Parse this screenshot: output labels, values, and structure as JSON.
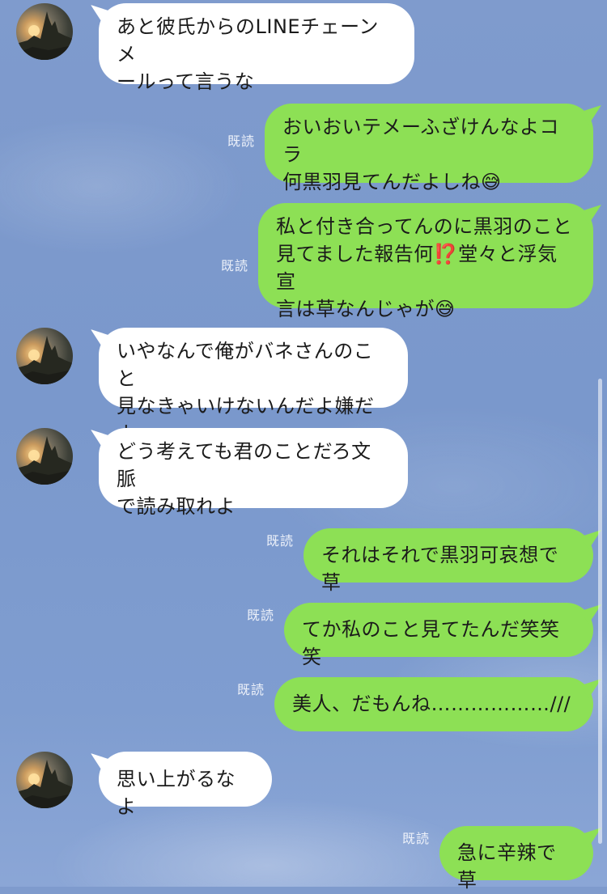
{
  "messages": [
    {
      "side": "in",
      "text": "あと彼氏からのLINEチェーンメ\nールって言うな"
    },
    {
      "side": "out",
      "read": "既読",
      "text": "おいおいテメーふざけんなよコラ\n何黒羽見てんだよしね😅"
    },
    {
      "side": "out",
      "read": "既読",
      "text": "私と付き合ってんのに黒羽のこと\n見てました報告何⁉️堂々と浮気宣\n言は草なんじゃが😅"
    },
    {
      "side": "in",
      "text": "いやなんで俺がバネさんのこと\n見なきゃいけないんだよ嫌だよ"
    },
    {
      "side": "in",
      "text": "どう考えても君のことだろ文脈\nで読み取れよ"
    },
    {
      "side": "out",
      "read": "既読",
      "text": "それはそれで黒羽可哀想で草"
    },
    {
      "side": "out",
      "read": "既読",
      "text": "てか私のこと見てたんだ笑笑笑"
    },
    {
      "side": "out",
      "read": "既読",
      "text": "美人、だもんね………………///"
    },
    {
      "side": "in",
      "text": "思い上がるなよ"
    },
    {
      "side": "out",
      "read": "既読",
      "text": "急に辛辣で草"
    }
  ],
  "colors": {
    "incoming_bubble": "#ffffff",
    "outgoing_bubble": "#8de055",
    "background": "#7f9bcd"
  },
  "icons": {
    "avatar": "castle-sunset-avatar"
  }
}
